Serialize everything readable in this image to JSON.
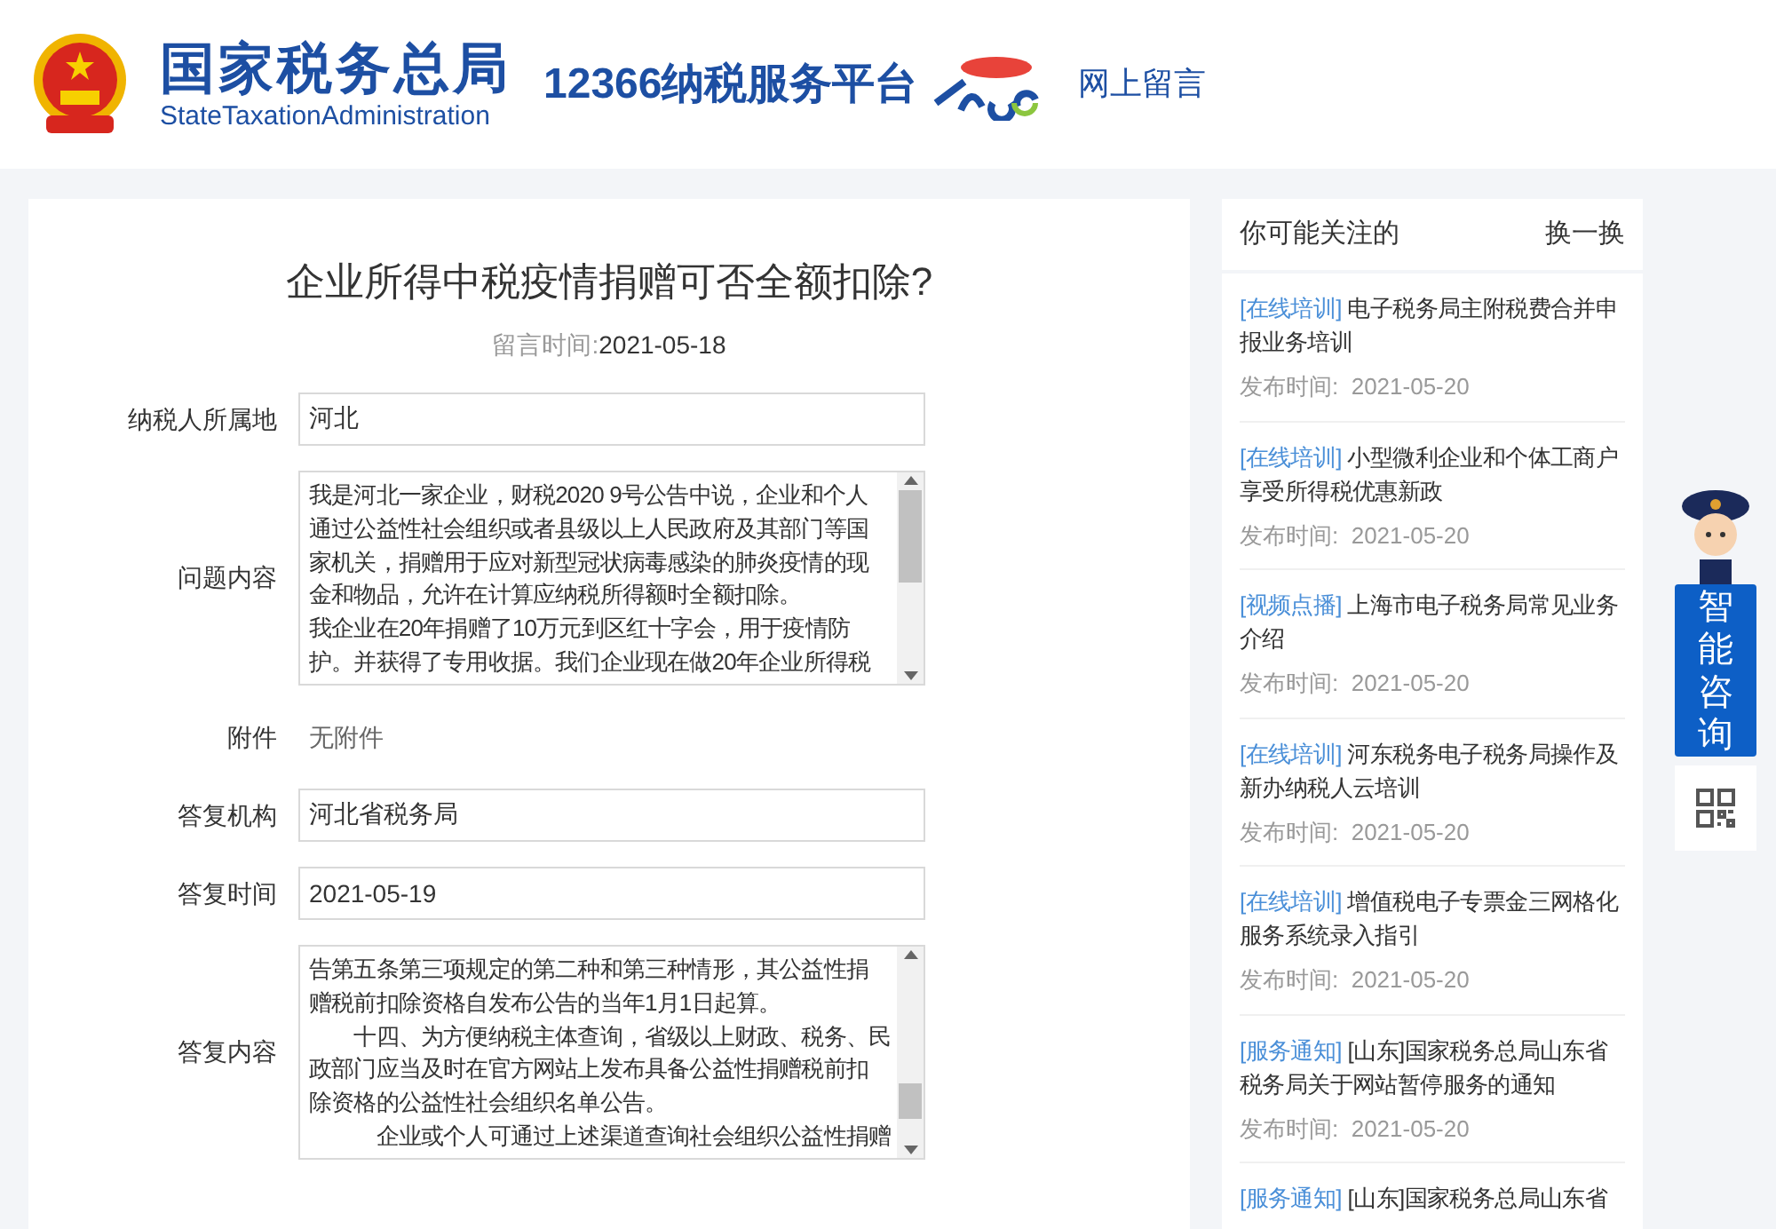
{
  "header": {
    "agency_name": "国家税务总局",
    "agency_name_en": "StateTaxationAdministration",
    "platform": "12366纳税服务平台",
    "nav_link": "网上留言"
  },
  "message": {
    "title": "企业所得中税疫情捐赠可否全额扣除?",
    "time_label": "留言时间:",
    "time": "2021-05-18",
    "fields": [
      {
        "kind": "input",
        "label": "纳税人所属地",
        "value": "河北"
      },
      {
        "kind": "textarea",
        "label": "问题内容",
        "lines": [
          "我是河北一家企业，财税2020 9号公告中说，企业和个人",
          "通过公益性社会组织或者县级以上人民政府及其部门等国",
          "家机关，捐赠用于应对新型冠状病毒感染的肺炎疫情的现",
          "金和物品，允许在计算应纳税所得额时全额扣除。",
          "我企业在20年捐赠了10万元到区红十字会，用于疫情防",
          "护。并获得了专用收据。我们企业现在做20年企业所得税"
        ]
      },
      {
        "kind": "text",
        "label": "附件",
        "value": "无附件"
      },
      {
        "kind": "input",
        "label": "答复机构",
        "value": "河北省税务局"
      },
      {
        "kind": "input",
        "label": "答复时间",
        "value": "2021-05-19"
      },
      {
        "kind": "textarea",
        "label": "答复内容",
        "lines": [
          "告第五条第三项规定的第二种和第三种情形，其公益性捐",
          "赠税前扣除资格自发布公告的当年1月1日起算。",
          "　　十四、为方便纳税主体查询，省级以上财政、税务、民",
          "政部门应当及时在官方网站上发布具备公益性捐赠税前扣",
          "除资格的公益性社会组织名单公告。",
          "　　　企业或个人可通过上述渠道查询社会组织公益性捐赠"
        ]
      }
    ]
  },
  "sidebar": {
    "title": "你可能关注的",
    "refresh": "换一换",
    "items": [
      {
        "tag": "[在线培训]",
        "title": "电子税务局主附税费合并申报业务培训",
        "date_label": "发布时间:",
        "date": "2021-05-20"
      },
      {
        "tag": "[在线培训]",
        "title": "小型微利企业和个体工商户享受所得税优惠新政",
        "date_label": "发布时间:",
        "date": "2021-05-20"
      },
      {
        "tag": "[视频点播]",
        "title": "上海市电子税务局常见业务介绍",
        "date_label": "发布时间:",
        "date": "2021-05-20"
      },
      {
        "tag": "[在线培训]",
        "title": "河东税务电子税务局操作及新办纳税人云培训",
        "date_label": "发布时间:",
        "date": "2021-05-20"
      },
      {
        "tag": "[在线培训]",
        "title": "增值税电子专票金三网格化服务系统录入指引",
        "date_label": "发布时间:",
        "date": "2021-05-20"
      },
      {
        "tag": "[服务通知]",
        "title": "[山东]国家税务总局山东省税务局关于网站暂停服务的通知",
        "date_label": "发布时间:",
        "date": "2021-05-20"
      },
      {
        "tag": "[服务通知]",
        "title": "[山东]国家税务总局山东省"
      }
    ]
  },
  "float_widget": {
    "consult_label": "智能咨询"
  }
}
